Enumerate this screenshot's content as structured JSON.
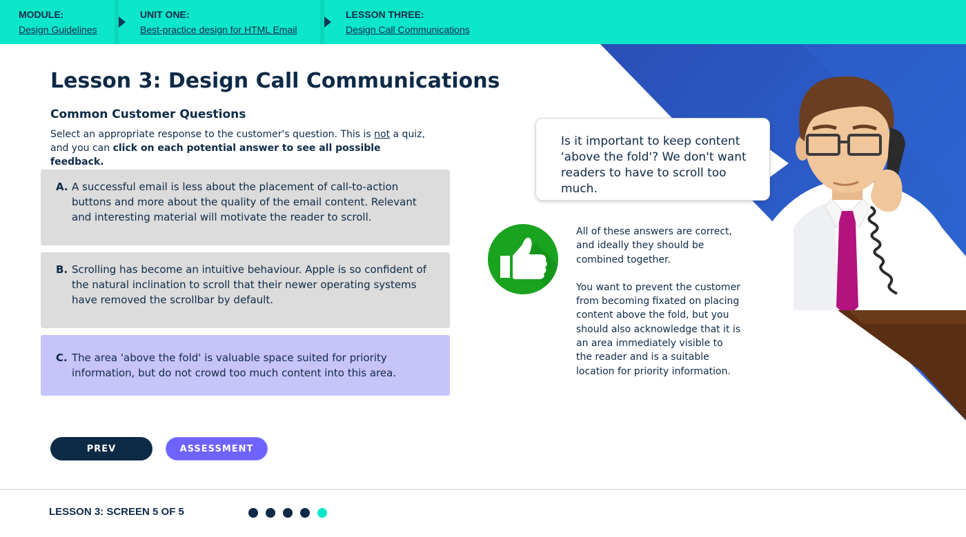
{
  "breadcrumb": [
    {
      "label": "MODULE:",
      "link": "Design Guidelines"
    },
    {
      "label": "UNIT ONE:",
      "link": "Best-practice design for HTML Email"
    },
    {
      "label": "LESSON THREE:",
      "link": "Design Call Communications"
    }
  ],
  "lesson": {
    "title": "Lesson 3: Design Call Communications",
    "subtitle": "Common Customer Questions",
    "intro_part1": "Select an appropriate response to the customer's question. This is ",
    "intro_emph": "not",
    "intro_part2": " a quiz, and you can ",
    "intro_bold": "click on each potential answer to see all possible feedback."
  },
  "answers": [
    {
      "letter": "A.",
      "text": "A successful email is less about the placement of call-to-action buttons and more about the quality of the email content. Relevant and interesting material will motivate the reader to scroll.",
      "selected": false
    },
    {
      "letter": "B.",
      "text": "Scrolling has become an intuitive behaviour. Apple is so confident of the natural inclination to scroll that their newer operating systems have removed the scrollbar by default.",
      "selected": false
    },
    {
      "letter": "C.",
      "text": "The area 'above the fold' is valuable space suited for priority information, but do not crowd too much content into this area.",
      "selected": true
    }
  ],
  "customer_question": "Is it important to keep content 'above the fold'? We don't want readers to have to scroll too much.",
  "feedback": {
    "icon": "thumbs-up-icon",
    "paragraph1": "All of these answers are correct, and ideally they should be combined together.",
    "paragraph2": "You want to prevent the customer from becoming fixated on placing content above the fold, but you should also acknowledge that it is an area immediately visible to the reader and is a suitable location for priority information."
  },
  "buttons": {
    "prev": "PREV",
    "assessment": "ASSESSMENT"
  },
  "footer": {
    "status": "LESSON 3: SCREEN 5 OF 5",
    "total_screens": 5,
    "current_screen": 5
  },
  "colors": {
    "accent": "#0ce6c9",
    "navy": "#0d2a47",
    "selected_answer": "#c7c3fb",
    "assessment_button": "#6e63ff",
    "correct_green": "#1aa31f",
    "background_blue": "#2a55c0"
  }
}
